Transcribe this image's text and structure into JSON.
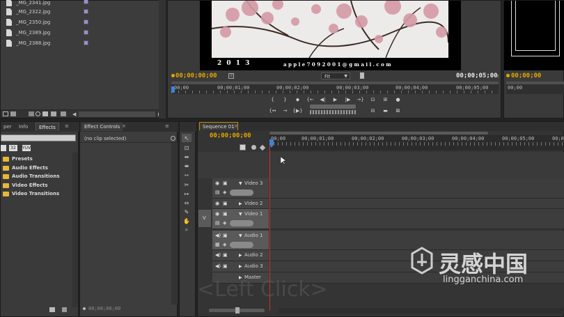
{
  "project": {
    "files": [
      "_MG_2341.jpg",
      "_MG_2322.jpg",
      "_MG_2350.jpg",
      "_MG_2389.jpg",
      "_MG_2388.jpg"
    ]
  },
  "program_monitor": {
    "overlay_left": "2 0 1 3",
    "overlay_right": "a p p l e 7 0 9 2 0 0 1 @ g m a i l . c o m",
    "timecode_current": "00;00;00;00",
    "timecode_duration": "00;00;05;00",
    "fit_label": "Fit",
    "ruler": [
      "00;00",
      "00;00;01;00",
      "00;00;02;00",
      "00;00;03;00",
      "00;00;04;00",
      "00;00;05;00"
    ]
  },
  "right_monitor": {
    "timecode_current": "00;00;00"
  },
  "effects_panel": {
    "tabs": [
      "per",
      "Info",
      "Effects"
    ],
    "items": [
      "Presets",
      "Audio Effects",
      "Audio Transitions",
      "Video Effects",
      "Video Transitions"
    ]
  },
  "effect_controls": {
    "tab_label": "Effect Controls",
    "no_clip": "(no clip selected)",
    "timecode": "00;00;00;00"
  },
  "timeline": {
    "sequence_tab": "Sequence 01",
    "timecode": "00;00;00;00",
    "ruler": [
      "00;00",
      "00;00;01;00",
      "00;00;02;00",
      "00;00;03;00",
      "00;00;04;00",
      "00;00;05;00",
      "00;00"
    ],
    "source_track_label": "V",
    "tracks": [
      "Video 3",
      "Video 2",
      "Video 1",
      "Audio 1",
      "Audio 2",
      "Audio 3",
      "Master"
    ]
  },
  "overlay_text": "<Left Click>",
  "watermark": {
    "brand_cn": "灵感中国",
    "brand_url": "lingganchina.com"
  },
  "colors": {
    "timecode_yellow": "#e2a700",
    "playhead_red": "#d0302a",
    "folder_yellow": "#e5b83a",
    "track_selected": "#5a5a5a"
  }
}
